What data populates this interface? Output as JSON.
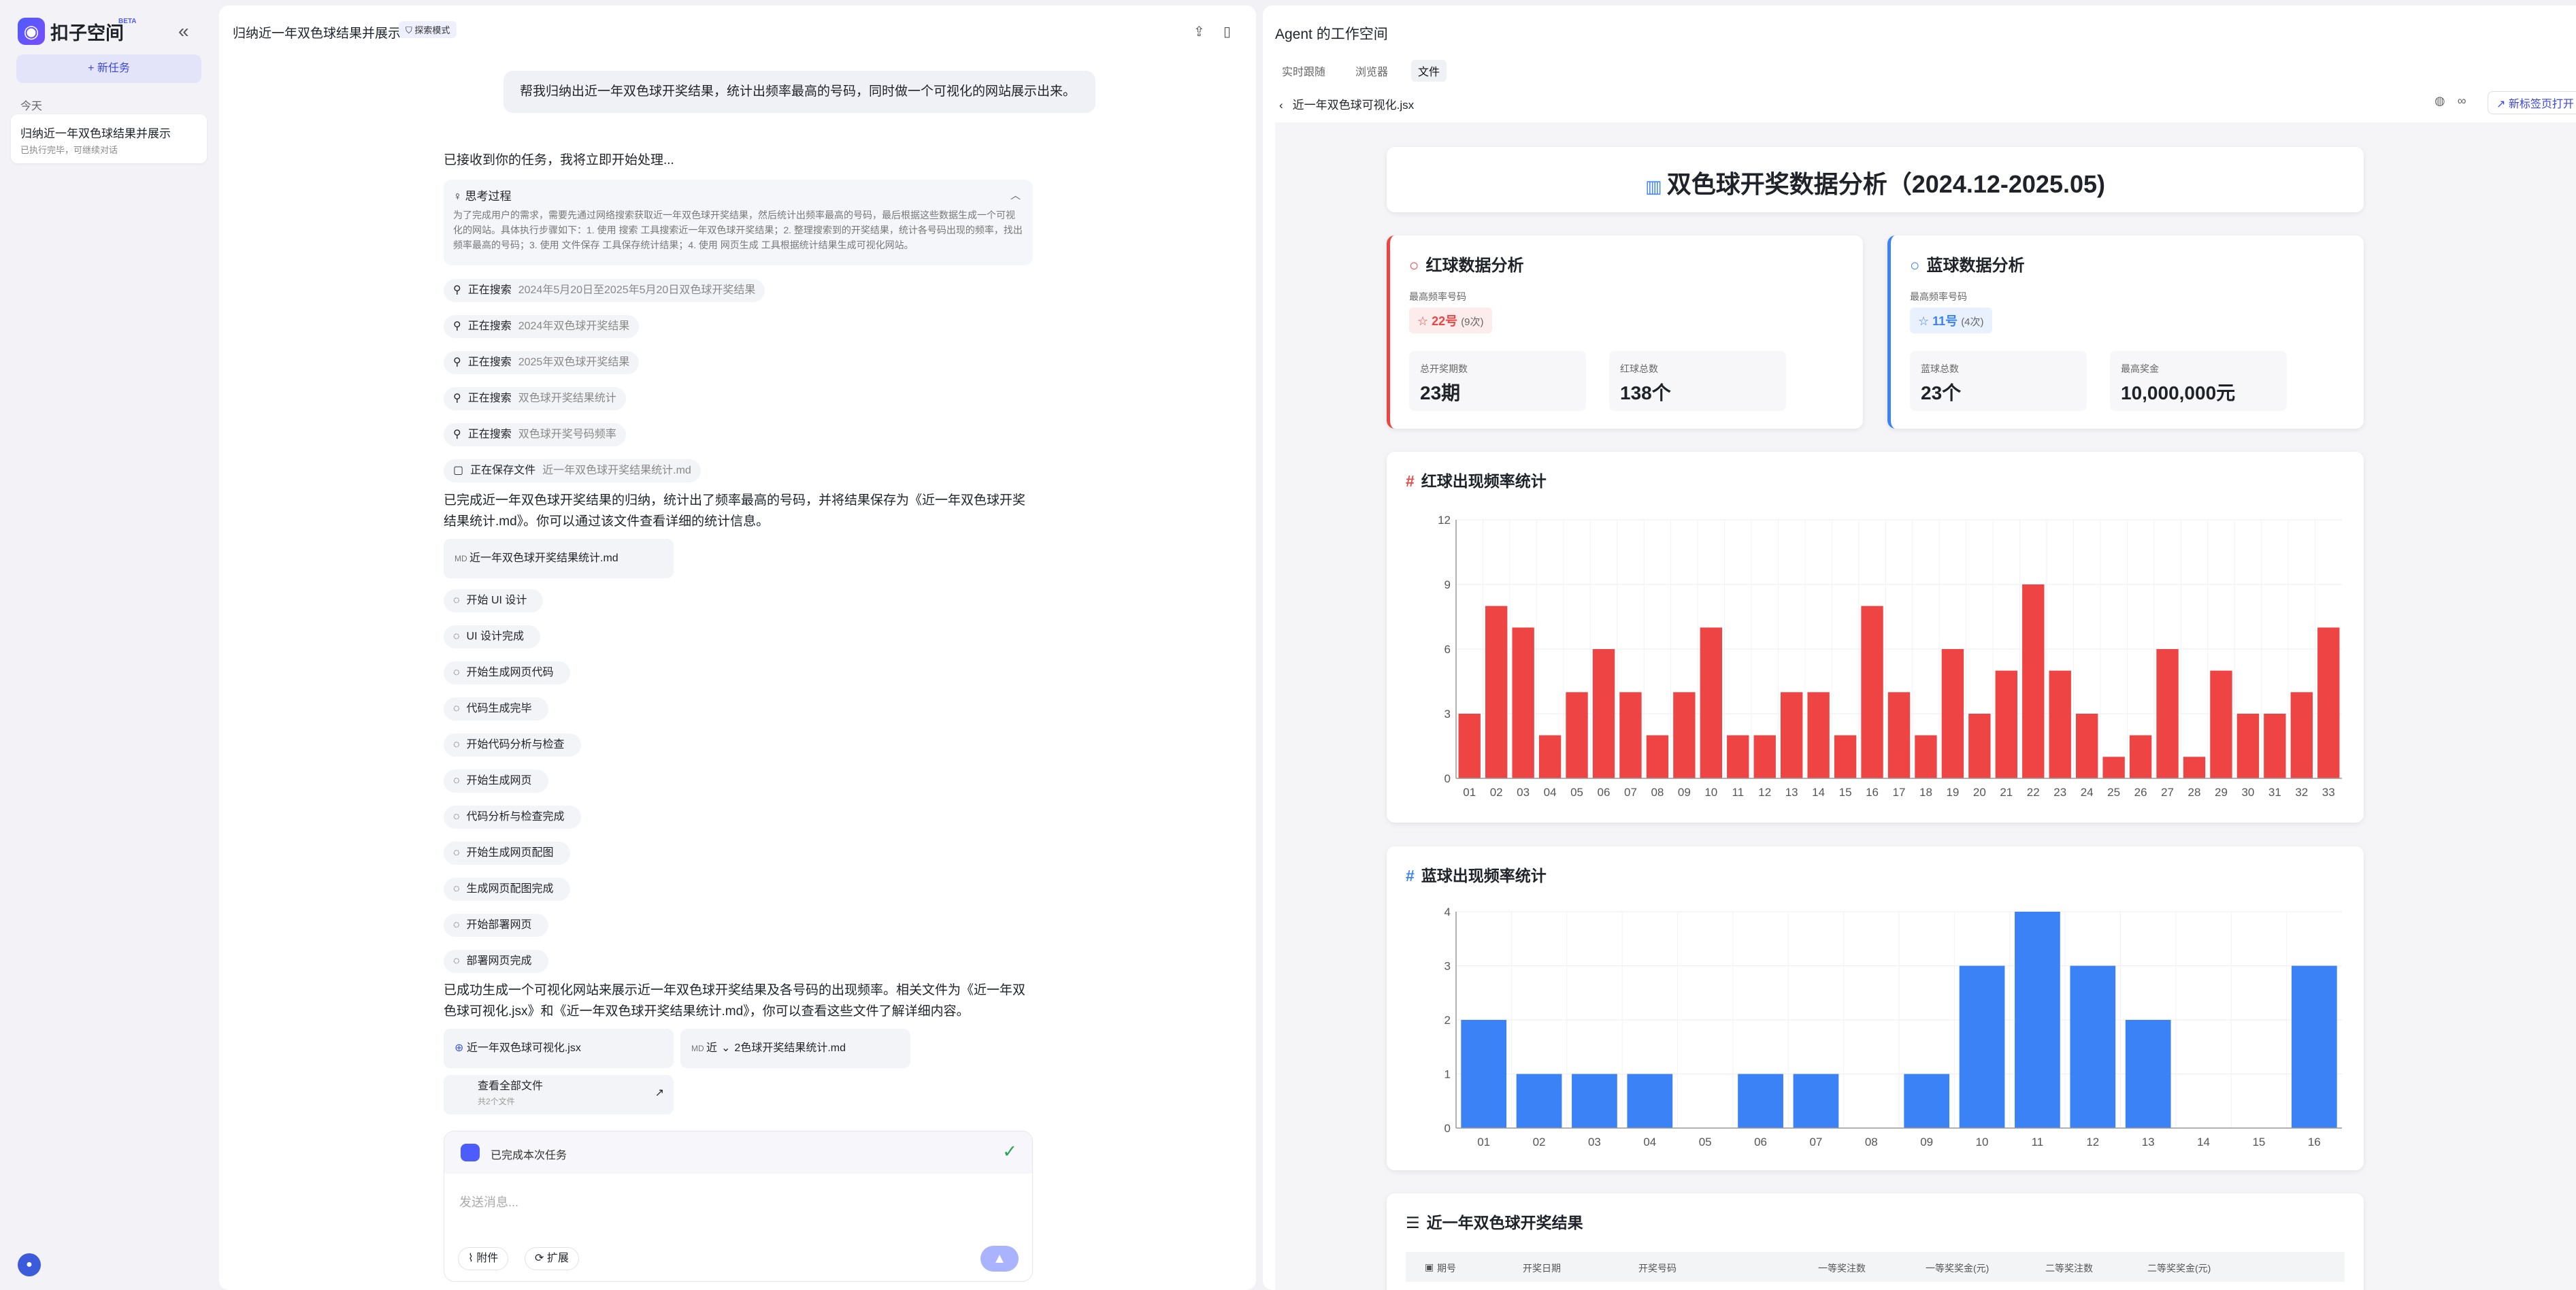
{
  "sidebar": {
    "brand": "扣子空间",
    "beta": "BETA",
    "new_task": "+ 新任务",
    "today": "今天",
    "history": [
      {
        "title": "归纳近一年双色球结果并展示",
        "sub": "已执行完毕，可继续对话"
      }
    ]
  },
  "chat": {
    "title": "归纳近一年双色球结果并展示",
    "mode": "探索模式",
    "user_msg": "帮我归纳出近一年双色球开奖结果，统计出频率最高的号码，同时做一个可视化的网站展示出来。",
    "ack": "已接收到你的任务，我将立即开始处理...",
    "think_title": "思考过程",
    "think_body": "为了完成用户的需求，需要先通过网络搜索获取近一年双色球开奖结果，然后统计出频率最高的号码，最后根据这些数据生成一个可视化的网站。具体执行步骤如下：1. 使用 搜索 工具搜索近一年双色球开奖结果；2. 整理搜索到的开奖结果，统计各号码出现的频率，找出频率最高的号码；3. 使用 文件保存 工具保存统计结果；4. 使用 网页生成 工具根据统计结果生成可视化网站。",
    "searching": "正在搜索",
    "searches": [
      "2024年5月20日至2025年5月20日双色球开奖结果",
      "2024年双色球开奖结果",
      "2025年双色球开奖结果",
      "双色球开奖结果统计",
      "双色球开奖号码频率"
    ],
    "saving": "正在保存文件",
    "save_file": "近一年双色球开奖结果统计.md",
    "done_text": "已完成近一年双色球开奖结果的归纳，统计出了频率最高的号码，并将结果保存为《近一年双色球开奖结果统计.md》。你可以通过该文件查看详细的统计信息。",
    "md_card": "近一年双色球开奖结果统计.md",
    "steps": [
      "开始 UI 设计",
      "UI 设计完成",
      "开始生成网页代码",
      "代码生成完毕",
      "开始代码分析与检查",
      "开始生成网页",
      "代码分析与检查完成",
      "开始生成网页配图",
      "生成网页配图完成",
      "开始部署网页",
      "部署网页完成"
    ],
    "final_text": "已成功生成一个可视化网站来展示近一年双色球开奖结果及各号码的出现频率。相关文件为《近一年双色球可视化.jsx》和《近一年双色球开奖结果统计.md》，你可以查看这些文件了解详细内容。",
    "file1": "近一年双色球可视化.jsx",
    "file2": "近一年双色球开奖结果统计.md",
    "file2_prefix": "近",
    "file2_suffix": "2色球开奖结果统计.md",
    "all_files": "查看全部文件",
    "all_files_sub": "共2个文件",
    "task_done": "已完成本次任务",
    "input_placeholder": "发送消息...",
    "attach": "附件",
    "extend": "扩展"
  },
  "workspace": {
    "title": "Agent 的工作空间",
    "tabs": [
      "实时跟随",
      "浏览器",
      "文件"
    ],
    "file": "近一年双色球可视化.jsx",
    "open_new": "新标签页打开",
    "page_title": "双色球开奖数据分析（2024.12-2025.05)",
    "red": {
      "title": "红球数据分析",
      "top_label": "最高频率号码",
      "top_value": "22号",
      "top_count": "(9次)",
      "total_label": "总开奖期数",
      "total": "23期",
      "balls_label": "红球总数",
      "balls": "138个"
    },
    "blue": {
      "title": "蓝球数据分析",
      "top_label": "最高频率号码",
      "top_value": "11号",
      "top_count": "(4次)",
      "balls_label": "蓝球总数",
      "balls": "23个",
      "prize_label": "最高奖金",
      "prize": "10,000,000元"
    },
    "red_chart_title": "红球出现频率统计",
    "blue_chart_title": "蓝球出现频率统计",
    "table_title": "近一年双色球开奖结果",
    "table_headers": [
      "期号",
      "开奖日期",
      "开奖号码",
      "一等奖注数",
      "一等奖奖金(元)",
      "二等奖注数",
      "二等奖奖金(元)"
    ]
  },
  "colors": {
    "accent": "#4c5cff",
    "red": "#ef4444",
    "blue": "#3b82f6"
  },
  "chart_data": [
    {
      "type": "bar",
      "title": "红球出现频率统计",
      "categories": [
        "01",
        "02",
        "03",
        "04",
        "05",
        "06",
        "07",
        "08",
        "09",
        "10",
        "11",
        "12",
        "13",
        "14",
        "15",
        "16",
        "17",
        "18",
        "19",
        "20",
        "21",
        "22",
        "23",
        "24",
        "25",
        "26",
        "27",
        "28",
        "29",
        "30",
        "31",
        "32",
        "33"
      ],
      "values": [
        3,
        8,
        7,
        2,
        4,
        6,
        4,
        2,
        4,
        7,
        2,
        2,
        4,
        4,
        2,
        8,
        4,
        2,
        6,
        3,
        5,
        9,
        5,
        3,
        1,
        2,
        6,
        1,
        5,
        3,
        3,
        4,
        7
      ],
      "ylim": [
        0,
        12
      ],
      "yticks": [
        0,
        3,
        6,
        9,
        12
      ],
      "color": "#ef4444",
      "grid": true
    },
    {
      "type": "bar",
      "title": "蓝球出现频率统计",
      "categories": [
        "01",
        "02",
        "03",
        "04",
        "05",
        "06",
        "07",
        "08",
        "09",
        "10",
        "11",
        "12",
        "13",
        "14",
        "15",
        "16"
      ],
      "values": [
        2,
        1,
        1,
        1,
        0,
        1,
        1,
        0,
        1,
        3,
        4,
        3,
        2,
        0,
        0,
        3
      ],
      "ylim": [
        0,
        4
      ],
      "yticks": [
        0,
        1,
        2,
        3,
        4
      ],
      "color": "#3b82f6",
      "grid": true
    }
  ]
}
